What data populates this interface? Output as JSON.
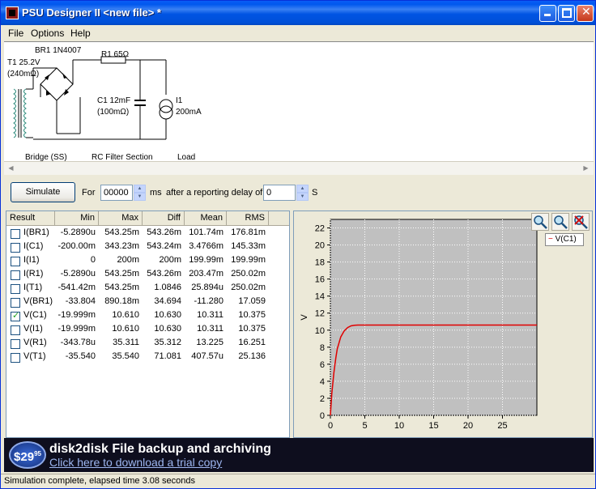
{
  "window": {
    "title": "PSU Designer II  <new file> *"
  },
  "menu": {
    "file": "File",
    "options": "Options",
    "help": "Help"
  },
  "schematic": {
    "transformer": "T1 25.2V",
    "transformer_res": "(240mΩ)",
    "bridge": "BR1 1N4007",
    "resistor": "R1 65Ω",
    "capacitor": "C1 12mF",
    "capacitor_res": "(100mΩ)",
    "load": "I1",
    "load_value": "200mA",
    "bridge_section": "Bridge (SS)",
    "filter_section": "RC Filter Section",
    "load_section": "Load"
  },
  "controls": {
    "simulate": "Simulate",
    "for_label": "For",
    "duration": "00000",
    "ms_label": "ms",
    "delay_label": "after a reporting delay of",
    "delay": "0",
    "s_label": "S"
  },
  "results": {
    "headers": [
      "Result",
      "Min",
      "Max",
      "Diff",
      "Mean",
      "RMS"
    ],
    "rows": [
      {
        "name": "I(BR1)",
        "min": "-5.2890u",
        "max": "543.25m",
        "diff": "543.26m",
        "mean": "101.74m",
        "rms": "176.81m",
        "checked": false
      },
      {
        "name": "I(C1)",
        "min": "-200.00m",
        "max": "343.23m",
        "diff": "543.24m",
        "mean": "3.4766m",
        "rms": "145.33m",
        "checked": false
      },
      {
        "name": "I(I1)",
        "min": "0",
        "max": "200m",
        "diff": "200m",
        "mean": "199.99m",
        "rms": "199.99m",
        "checked": false
      },
      {
        "name": "I(R1)",
        "min": "-5.2890u",
        "max": "543.25m",
        "diff": "543.26m",
        "mean": "203.47m",
        "rms": "250.02m",
        "checked": false
      },
      {
        "name": "I(T1)",
        "min": "-541.42m",
        "max": "543.25m",
        "diff": "1.0846",
        "mean": "25.894u",
        "rms": "250.02m",
        "checked": false
      },
      {
        "name": "V(BR1)",
        "min": "-33.804",
        "max": "890.18m",
        "diff": "34.694",
        "mean": "-11.280",
        "rms": "17.059",
        "checked": false
      },
      {
        "name": "V(C1)",
        "min": "-19.999m",
        "max": "10.610",
        "diff": "10.630",
        "mean": "10.311",
        "rms": "10.375",
        "checked": true
      },
      {
        "name": "V(I1)",
        "min": "-19.999m",
        "max": "10.610",
        "diff": "10.630",
        "mean": "10.311",
        "rms": "10.375",
        "checked": false
      },
      {
        "name": "V(R1)",
        "min": "-343.78u",
        "max": "35.311",
        "diff": "35.312",
        "mean": "13.225",
        "rms": "16.251",
        "checked": false
      },
      {
        "name": "V(T1)",
        "min": "-35.540",
        "max": "35.540",
        "diff": "71.081",
        "mean": "407.57u",
        "rms": "25.136",
        "checked": false
      }
    ]
  },
  "chart_data": {
    "type": "line",
    "ylabel": "V",
    "xlabel": "",
    "xlim": [
      0,
      30
    ],
    "ylim": [
      0,
      23
    ],
    "xticks": [
      "0",
      "5",
      "10",
      "15",
      "20",
      "25"
    ],
    "yticks": [
      "0",
      "2",
      "4",
      "6",
      "8",
      "10",
      "12",
      "14",
      "16",
      "18",
      "20",
      "22"
    ],
    "grid": true,
    "legend_position": "top-right",
    "series": [
      {
        "name": "V(C1)",
        "color": "#E00000",
        "x": [
          0,
          0.2,
          0.5,
          0.8,
          1.0,
          1.5,
          2.0,
          2.5,
          3.0,
          3.5,
          4.0,
          5.0,
          10,
          15,
          20,
          25,
          30
        ],
        "y": [
          0,
          2.5,
          5.0,
          6.8,
          7.8,
          9.2,
          9.9,
          10.3,
          10.5,
          10.57,
          10.6,
          10.6,
          10.6,
          10.6,
          10.6,
          10.6,
          10.6
        ]
      }
    ]
  },
  "banner": {
    "price": "$29",
    "price_cents": "95",
    "title": "disk2disk File backup and archiving",
    "link": "Click here to download a trial copy"
  },
  "status": {
    "text": "Simulation complete, elapsed time 3.08 seconds"
  },
  "colors": {
    "title_bar": "#0054E3",
    "plot_bg": "#C0C0C0",
    "trace": "#E00000"
  },
  "icons": [
    "app-icon",
    "minimize-icon",
    "maximize-icon",
    "close-icon",
    "zoom-in-icon",
    "zoom-out-icon",
    "zoom-reset-icon"
  ]
}
